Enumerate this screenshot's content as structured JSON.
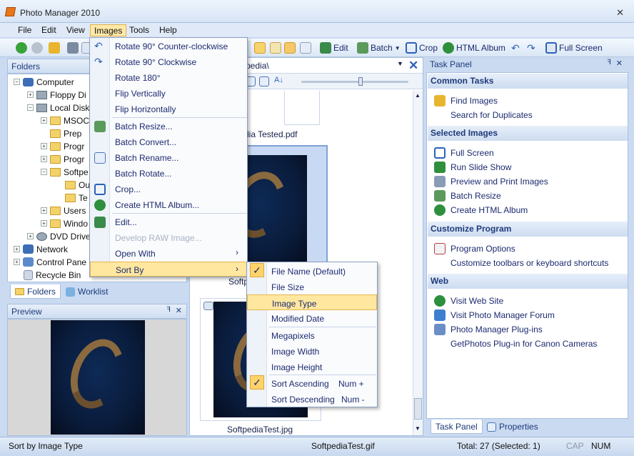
{
  "window": {
    "title": "Photo Manager 2010",
    "close_glyph": "✕"
  },
  "menubar": [
    "File",
    "Edit",
    "View",
    "Images",
    "Tools",
    "Help"
  ],
  "toolbar": {
    "edit": "Edit",
    "batch": "Batch",
    "crop": "Crop",
    "html_album": "HTML Album",
    "full_screen": "Full Screen"
  },
  "folders": {
    "header": "Folders",
    "tree": [
      {
        "label": "Computer",
        "expander": "−",
        "icon": "computer-icon"
      },
      {
        "label": "Floppy Di",
        "expander": "+",
        "icon": "floppy-icon"
      },
      {
        "label": "Local Disk",
        "expander": "−",
        "icon": "drive-icon"
      },
      {
        "label": "MSOC",
        "expander": "+",
        "icon": "folder-icon"
      },
      {
        "label": "Prep",
        "expander": "",
        "icon": "folder-icon"
      },
      {
        "label": "Progr",
        "expander": "+",
        "icon": "folder-icon"
      },
      {
        "label": "Progr",
        "expander": "+",
        "icon": "folder-icon"
      },
      {
        "label": "Softpe",
        "expander": "−",
        "icon": "folder-icon"
      },
      {
        "label": "Ou",
        "expander": "",
        "icon": "folder-icon"
      },
      {
        "label": "Te",
        "expander": "",
        "icon": "folder-icon"
      },
      {
        "label": "Users",
        "expander": "+",
        "icon": "folder-icon"
      },
      {
        "label": "Windo",
        "expander": "+",
        "icon": "folder-icon"
      },
      {
        "label": "DVD Drive",
        "expander": "+",
        "icon": "dvd-icon"
      },
      {
        "label": "Network",
        "expander": "+",
        "icon": "network-icon"
      },
      {
        "label": "Control Pane",
        "expander": "+",
        "icon": "control-panel-icon"
      },
      {
        "label": "Recycle Bin",
        "expander": "",
        "icon": "recycle-bin-icon"
      }
    ],
    "tabs": [
      "Folders",
      "Worklist"
    ]
  },
  "preview": {
    "header": "Preview"
  },
  "center": {
    "path": "pedia\\",
    "items": [
      {
        "caption": "dia Tested.pdf"
      },
      {
        "caption": "Softp"
      },
      {
        "caption": "SoftpediaTest.jpg"
      }
    ]
  },
  "images_menu": [
    {
      "label": "Rotate 90° Counter-clockwise",
      "icon": "rotate-ccw-icon"
    },
    {
      "label": "Rotate 90° Clockwise",
      "icon": "rotate-cw-icon"
    },
    {
      "label": "Rotate 180°",
      "icon": ""
    },
    {
      "label": "Flip Vertically",
      "icon": ""
    },
    {
      "label": "Flip Horizontally",
      "icon": ""
    },
    {
      "label": "Batch Resize...",
      "icon": "batch-resize-icon"
    },
    {
      "label": "Batch Convert...",
      "icon": ""
    },
    {
      "label": "Batch Rename...",
      "icon": "batch-rename-icon"
    },
    {
      "label": "Batch Rotate...",
      "icon": ""
    },
    {
      "label": "Crop...",
      "icon": "crop-icon"
    },
    {
      "label": "Create HTML Album...",
      "icon": "globe-icon"
    },
    {
      "label": "Edit...",
      "icon": "edit-icon"
    },
    {
      "label": "Develop RAW Image...",
      "icon": "",
      "disabled": true
    },
    {
      "label": "Open With",
      "icon": "",
      "arrow": "›"
    },
    {
      "label": "Sort By",
      "icon": "",
      "arrow": "›",
      "highlighted": true
    }
  ],
  "sort_menu": [
    {
      "label": "File Name (Default)",
      "checked": true,
      "shortcut": ""
    },
    {
      "label": "File Size",
      "checked": false,
      "shortcut": ""
    },
    {
      "label": "Image Type",
      "checked": false,
      "shortcut": "",
      "highlighted": true
    },
    {
      "label": "Modified Date",
      "checked": false,
      "shortcut": ""
    },
    {
      "label": "Megapixels",
      "checked": false,
      "shortcut": ""
    },
    {
      "label": "Image Width",
      "checked": false,
      "shortcut": ""
    },
    {
      "label": "Image Height",
      "checked": false,
      "shortcut": ""
    },
    {
      "label": "Sort Ascending",
      "checked": true,
      "shortcut": "Num +"
    },
    {
      "label": "Sort Descending",
      "checked": false,
      "shortcut": "Num -"
    }
  ],
  "check_glyph": "✓",
  "task_panel": {
    "header": "Task Panel",
    "sections": [
      {
        "title": "Common Tasks",
        "items": [
          {
            "label": "Find Images",
            "icon": "find-icon"
          },
          {
            "label": "Search for Duplicates",
            "icon": ""
          }
        ]
      },
      {
        "title": "Selected Images",
        "items": [
          {
            "label": "Full Screen",
            "icon": "fullscreen-icon"
          },
          {
            "label": "Run Slide Show",
            "icon": "slideshow-icon"
          },
          {
            "label": "Preview and Print Images",
            "icon": "print-icon"
          },
          {
            "label": "Batch Resize",
            "icon": "batch-resize-icon"
          },
          {
            "label": "Create HTML Album",
            "icon": "globe-icon"
          }
        ]
      },
      {
        "title": "Customize Program",
        "items": [
          {
            "label": "Program Options",
            "icon": "options-icon"
          },
          {
            "label": "Customize toolbars or keyboard shortcuts",
            "icon": ""
          }
        ]
      },
      {
        "title": "Web",
        "items": [
          {
            "label": "Visit Web Site",
            "icon": "globe-icon"
          },
          {
            "label": "Visit Photo Manager Forum",
            "icon": "forum-icon"
          },
          {
            "label": "Photo Manager Plug-ins",
            "icon": "plugin-icon"
          },
          {
            "label": "GetPhotos Plug-in for Canon Cameras",
            "icon": ""
          }
        ]
      }
    ],
    "tabs": [
      "Task Panel",
      "Properties"
    ]
  },
  "statusbar": {
    "left": "Sort by Image Type",
    "file": "SoftpediaTest.gif",
    "total": "Total: 27 (Selected: 1)",
    "cap": "CAP",
    "num": "NUM"
  },
  "colors": {
    "accent": "#ffe7a0",
    "section_text": "#1e3a7a"
  }
}
